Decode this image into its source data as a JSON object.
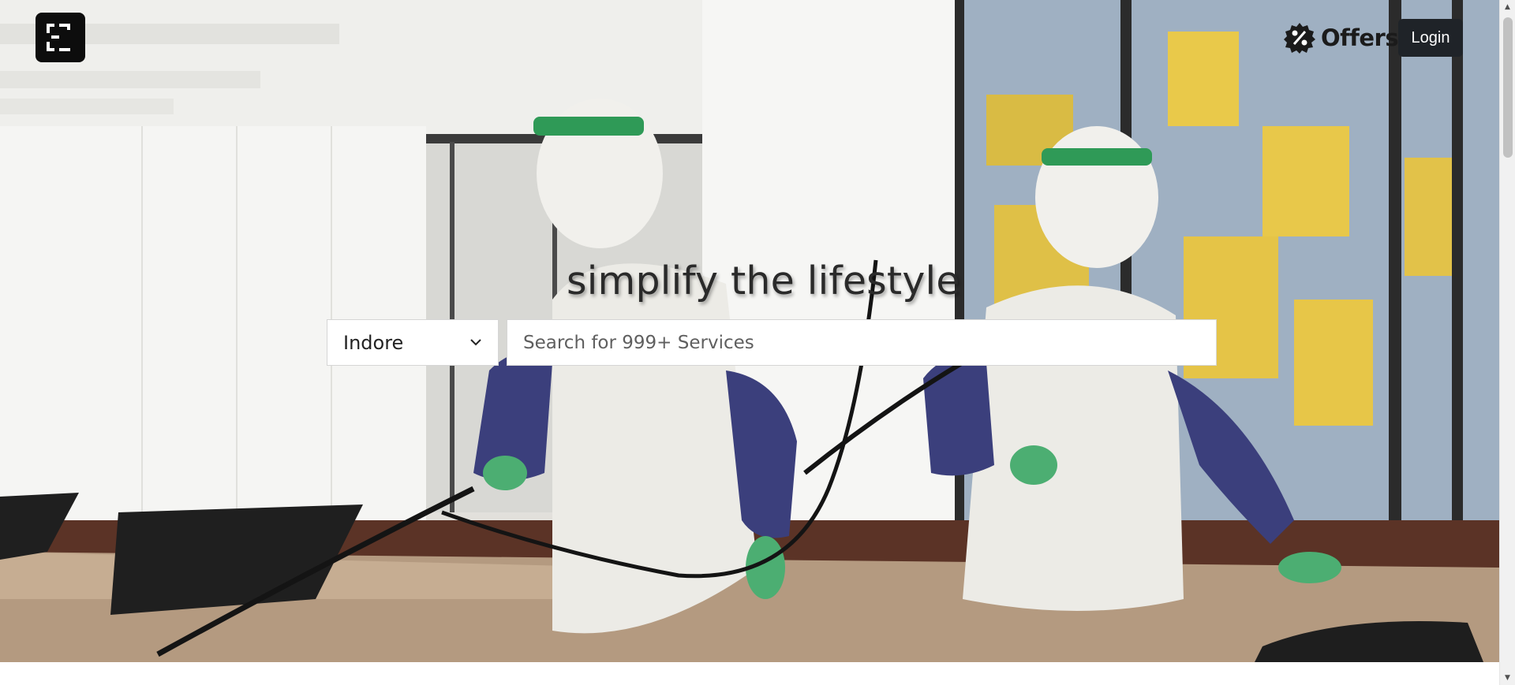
{
  "header": {
    "logo_icon": "brand-logo-icon",
    "offers": {
      "label": "Offers",
      "icon": "percent-badge-icon"
    },
    "login_label": "Login"
  },
  "hero": {
    "tagline": "simplify the lifestyle",
    "image": "hero-photo"
  },
  "search": {
    "city": "Indore",
    "placeholder": "Search for 999+ Services",
    "value": ""
  },
  "colors": {
    "button_bg": "#1f2328",
    "logo_bg": "#0d0d0d",
    "text_dark": "#2a2a2a"
  }
}
